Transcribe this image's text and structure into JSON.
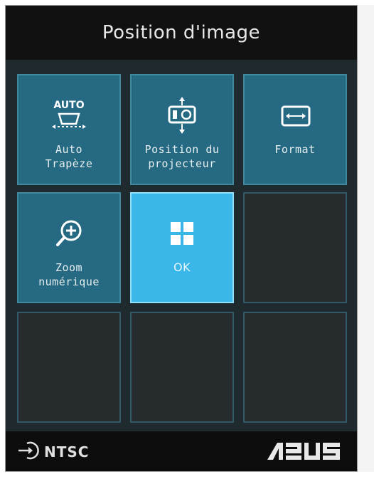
{
  "header": {
    "title": "Position d'image"
  },
  "tiles": [
    {
      "label": "Auto\nTrapèze",
      "icon": "auto-keystone-icon",
      "icon_text": "AUTO",
      "state": "normal"
    },
    {
      "label": "Position du\nprojecteur",
      "icon": "projector-position-icon",
      "state": "normal"
    },
    {
      "label": "Format",
      "icon": "aspect-ratio-icon",
      "state": "normal"
    },
    {
      "label": "Zoom\nnumérique",
      "icon": "zoom-in-icon",
      "state": "normal"
    },
    {
      "label": "OK",
      "icon": "grid-icon",
      "state": "selected"
    },
    {
      "label": "",
      "state": "empty"
    },
    {
      "label": "",
      "state": "empty"
    },
    {
      "label": "",
      "state": "empty"
    },
    {
      "label": "",
      "state": "empty"
    }
  ],
  "footer": {
    "source_label": "NTSC",
    "source_icon": "input-source-icon",
    "logo_text": "ASUS"
  },
  "colors": {
    "tile_normal": "#256982",
    "tile_selected": "#3ab6e8",
    "tile_empty": "#262b2d",
    "header_bg": "#111111"
  }
}
